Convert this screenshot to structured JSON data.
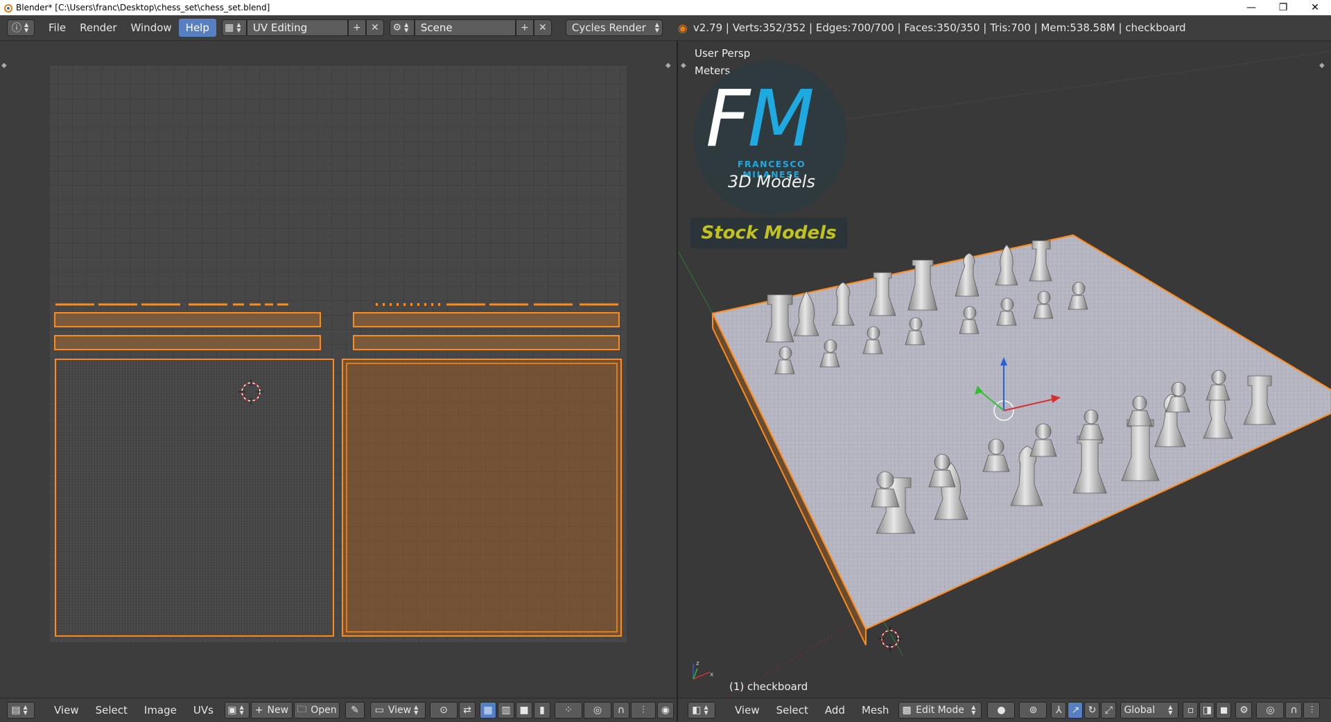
{
  "window": {
    "title": "Blender* [C:\\Users\\franc\\Desktop\\chess_set\\chess_set.blend]",
    "controls": {
      "minimize": "—",
      "restore": "❐",
      "close": "✕"
    }
  },
  "topbar": {
    "menus": [
      "File",
      "Render",
      "Window",
      "Help"
    ],
    "active_menu": "Help",
    "screen_layout": "UV Editing",
    "scene": "Scene",
    "render_engine": "Cycles Render",
    "stats": "v2.79 | Verts:352/352 | Edges:700/700 | Faces:350/350 | Tris:700 | Mem:538.58M | checkboard"
  },
  "uv_footer": {
    "menus": [
      "View",
      "Select",
      "Image",
      "UVs"
    ],
    "new_label": "New",
    "open_label": "Open",
    "view_label": "View"
  },
  "viewport": {
    "view_name": "User Persp",
    "units": "Meters",
    "object_label": "(1) checkboard"
  },
  "logo": {
    "initial_f": "F",
    "initial_m": "M",
    "name": "FRANCESCO MILANESE",
    "subtitle": "3D Models",
    "badge": "Stock Models"
  },
  "vp_footer": {
    "menus": [
      "View",
      "Select",
      "Add",
      "Mesh"
    ],
    "mode": "Edit Mode",
    "orientation": "Global"
  },
  "colors": {
    "selection_orange": "#ff8c1a",
    "uv_face_fill": "#7a5a3a",
    "logo_blue": "#1ea9e1",
    "stock_yellow": "#c2c21e",
    "menu_active": "#5680c2"
  }
}
